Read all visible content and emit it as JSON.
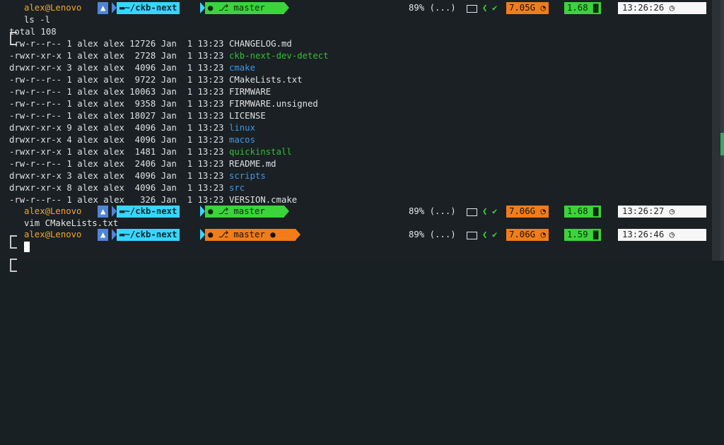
{
  "prompt": {
    "user_host": "alex@Lenovo",
    "dir": "~/ckb-next",
    "branch": "master",
    "battery": "89% (...)",
    "arch_icon": "arch-linux-icon",
    "folder_icon": "folder-icon",
    "github_icon": "github-icon",
    "branch_icon": "branch-icon"
  },
  "prompts": [
    {
      "memory": "7.05G",
      "load": "1.68",
      "time": "13:26:26",
      "command": "ls -l"
    },
    {
      "memory": "7.06G",
      "load": "1.68",
      "time": "13:26:27",
      "command": "vim CMakeLists.txt"
    },
    {
      "memory": "7.06G",
      "load": "1.59",
      "time": "13:26:46",
      "command": "",
      "git_warning": true
    }
  ],
  "ls_output": {
    "total": "total 108",
    "entries": [
      {
        "meta": "-rw-r--r-- 1 alex alex 12726 Jan  1 13:23 ",
        "name": "CHANGELOG.md",
        "kind": "file"
      },
      {
        "meta": "-rwxr-xr-x 1 alex alex  2728 Jan  1 13:23 ",
        "name": "ckb-next-dev-detect",
        "kind": "exe"
      },
      {
        "meta": "drwxr-xr-x 3 alex alex  4096 Jan  1 13:23 ",
        "name": "cmake",
        "kind": "dir"
      },
      {
        "meta": "-rw-r--r-- 1 alex alex  9722 Jan  1 13:23 ",
        "name": "CMakeLists.txt",
        "kind": "file"
      },
      {
        "meta": "-rw-r--r-- 1 alex alex 10063 Jan  1 13:23 ",
        "name": "FIRMWARE",
        "kind": "file"
      },
      {
        "meta": "-rw-r--r-- 1 alex alex  9358 Jan  1 13:23 ",
        "name": "FIRMWARE.unsigned",
        "kind": "file"
      },
      {
        "meta": "-rw-r--r-- 1 alex alex 18027 Jan  1 13:23 ",
        "name": "LICENSE",
        "kind": "file"
      },
      {
        "meta": "drwxr-xr-x 9 alex alex  4096 Jan  1 13:23 ",
        "name": "linux",
        "kind": "dir"
      },
      {
        "meta": "drwxr-xr-x 4 alex alex  4096 Jan  1 13:23 ",
        "name": "macos",
        "kind": "dir"
      },
      {
        "meta": "-rwxr-xr-x 1 alex alex  1481 Jan  1 13:23 ",
        "name": "quickinstall",
        "kind": "exe"
      },
      {
        "meta": "-rw-r--r-- 1 alex alex  2406 Jan  1 13:23 ",
        "name": "README.md",
        "kind": "file"
      },
      {
        "meta": "drwxr-xr-x 3 alex alex  4096 Jan  1 13:23 ",
        "name": "scripts",
        "kind": "dir"
      },
      {
        "meta": "drwxr-xr-x 8 alex alex  4096 Jan  1 13:23 ",
        "name": "src",
        "kind": "dir"
      },
      {
        "meta": "-rw-r--r-- 1 alex alex   326 Jan  1 13:23 ",
        "name": "VERSION.cmake",
        "kind": "file"
      }
    ]
  },
  "colors": {
    "background": "#1a2024",
    "user_host": "#f5a623",
    "arch_segment": "#4f86d8",
    "path_segment": "#38d6ff",
    "git_clean": "#3bd43b",
    "git_dirty": "#f07d1a",
    "memory_segment": "#f07d1a",
    "load_segment": "#3bd43b",
    "time_segment": "#f7f7f7",
    "directory": "#3f97e8",
    "executable": "#2fc12f"
  }
}
